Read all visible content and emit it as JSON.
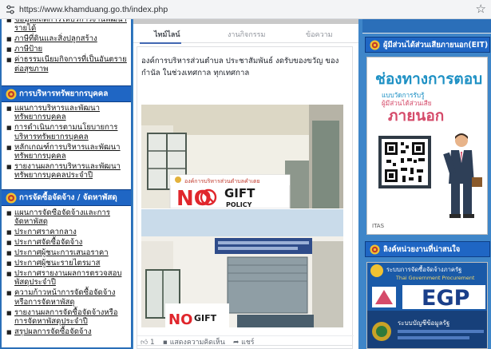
{
  "browser": {
    "url": "https://www.khamduang.go.th/index.php",
    "site_icon": "site-settings-icon",
    "bookmark_icon": "star-icon"
  },
  "left": {
    "section_a": {
      "items": [
        "ข้อมูลสถิติการให้บริการงานพัฒนารายได้",
        "ภาษีที่ดินและสิ่งปลูกสร้าง",
        "ภาษีป้าย",
        "ค่าธรรมเนียมกิจการที่เป็นอันตรายต่อสุขภาพ"
      ]
    },
    "section_b": {
      "title": "การบริหารทรัพยากรบุคคล",
      "items": [
        "แผนการบริหารและพัฒนาทรัพยากรบุคคล",
        "การดำเนินการตามนโยบายการบริหารทรัพยากรบุคคล",
        "หลักเกณฑ์การบริหารและพัฒนาทรัพยากรบุคคล",
        "รายงานผลการบริหารและพัฒนาทรัพยากรบุคคลประจำปี"
      ]
    },
    "section_c": {
      "title": "การจัดซื้อจัดจ้าง / จัดหาพัสดุ",
      "items": [
        "แผนการจัดซื้อจัดจ้างและการจัดหาพัสดุ",
        "ประกาศราคากลาง",
        "ประกาศจัดซื้อจัดจ้าง",
        "ประกาศผู้ชนะการเสนอราคา",
        "ประกาศผู้ชนะรายไตรมาส",
        "ประกาศรายงานผลการตรวจสอบพัสดุประจำปี",
        "ความก้าวหน้าการจัดซื้อจัดจ้างหรือการจัดหาพัสดุ",
        "รายงานผลการจัดซื้อจัดจ้างหรือการจัดหาพัสดุประจำปี",
        "สรุปผลการจัดซื้อจัดจ้าง"
      ]
    }
  },
  "feed": {
    "tabs": [
      "ไทม์ไลน์",
      "งานกิจกรรม",
      "ข้อความ"
    ],
    "post_text": "องค์การบริหารส่วนตำบล ประชาสัมพันธ์ งดรับของขวัญ ของกำนัล ในช่วงเทศกาล ทุกเทศกาล",
    "sign_banner": "องค์การบริหารส่วนตำบลคำเตย",
    "sign_no": "NO",
    "sign_gift": "GIFT",
    "sign_policy": "POLICY",
    "like_count": "1",
    "comment_label": "แสดงความคิดเห็น",
    "share_label": "แชร์"
  },
  "right": {
    "eit_header": "ผู้มีส่วนได้ส่วนเสียภายนอก(EIT)",
    "eit_title": "ช่องทางการตอบ",
    "eit_sub1": "แบบวัดการรับรู้",
    "eit_sub2": "ผู้มีส่วนได้ส่วนเสีย",
    "eit_big": "ภายนอก",
    "eit_logo": "ITAS",
    "link_header": "ลิงค์หน่วยงานที่น่าสนใจ",
    "egp_line1": "ระบบการจัดซื้อจัดจ้างภาครัฐ",
    "egp_line2": "Thai Government Procurement",
    "egp_brand": "EGP",
    "egp_line3": "ระบบบัญชีข้อมูลรัฐ"
  },
  "colors": {
    "page_bg": "#3f86c9",
    "section_header": "#1f66c4",
    "eit_blue": "#1d90c4",
    "eit_pink": "#d54b6a",
    "gift_red": "#e0262c"
  }
}
